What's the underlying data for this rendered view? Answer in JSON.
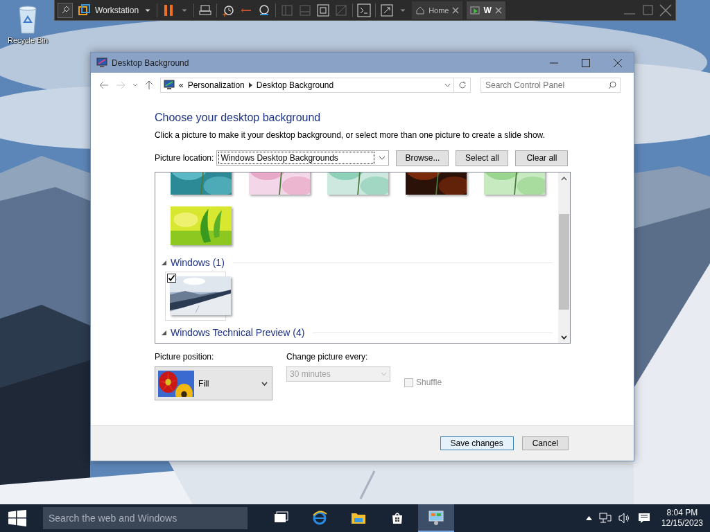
{
  "desktop": {
    "icons": [
      {
        "label": "Recycle Bin"
      }
    ]
  },
  "vm_toolbar": {
    "vm_name": "Workstation",
    "tabs": [
      {
        "label": "Home",
        "selected": false
      },
      {
        "label": "W",
        "selected": true
      }
    ]
  },
  "window": {
    "title": "Desktop Background",
    "address": {
      "prefix": "«",
      "crumbs": [
        "Personalization",
        "Desktop Background"
      ]
    },
    "search": {
      "placeholder": "Search Control Panel"
    },
    "heading": "Choose your desktop background",
    "description": "Click a picture to make it your desktop background, or select more than one picture to create a slide show.",
    "picture_location": {
      "label": "Picture location:",
      "value": "Windows Desktop Backgrounds"
    },
    "buttons": [
      "Browse...",
      "Select all",
      "Clear all"
    ],
    "gallery": {
      "groups": [
        {
          "items": [
            {
              "checked": false
            },
            {
              "checked": false
            },
            {
              "checked": false
            },
            {
              "checked": false
            },
            {
              "checked": false
            },
            {
              "checked": false
            }
          ]
        },
        {
          "title": "Windows (1)",
          "expanded": true,
          "items": [
            {
              "checked": true
            }
          ]
        },
        {
          "title": "Windows Technical Preview (4)",
          "expanded": true
        }
      ]
    },
    "picture_position": {
      "label": "Picture position:",
      "value": "Fill"
    },
    "change_picture": {
      "label": "Change picture every:",
      "value": "30 minutes",
      "disabled": true
    },
    "shuffle": {
      "label": "Shuffle",
      "checked": false,
      "disabled": true
    },
    "footer_buttons": [
      {
        "label": "Save changes",
        "default": true
      },
      {
        "label": "Cancel",
        "default": false
      }
    ]
  },
  "taskbar": {
    "search": {
      "placeholder": "Search the web and Windows"
    },
    "apps": [
      {
        "selected": false
      },
      {
        "selected": false
      },
      {
        "selected": false
      },
      {
        "selected": false
      },
      {
        "selected": true
      }
    ],
    "clock": {
      "time": "8:04 PM",
      "date": "12/15/2023"
    }
  }
}
